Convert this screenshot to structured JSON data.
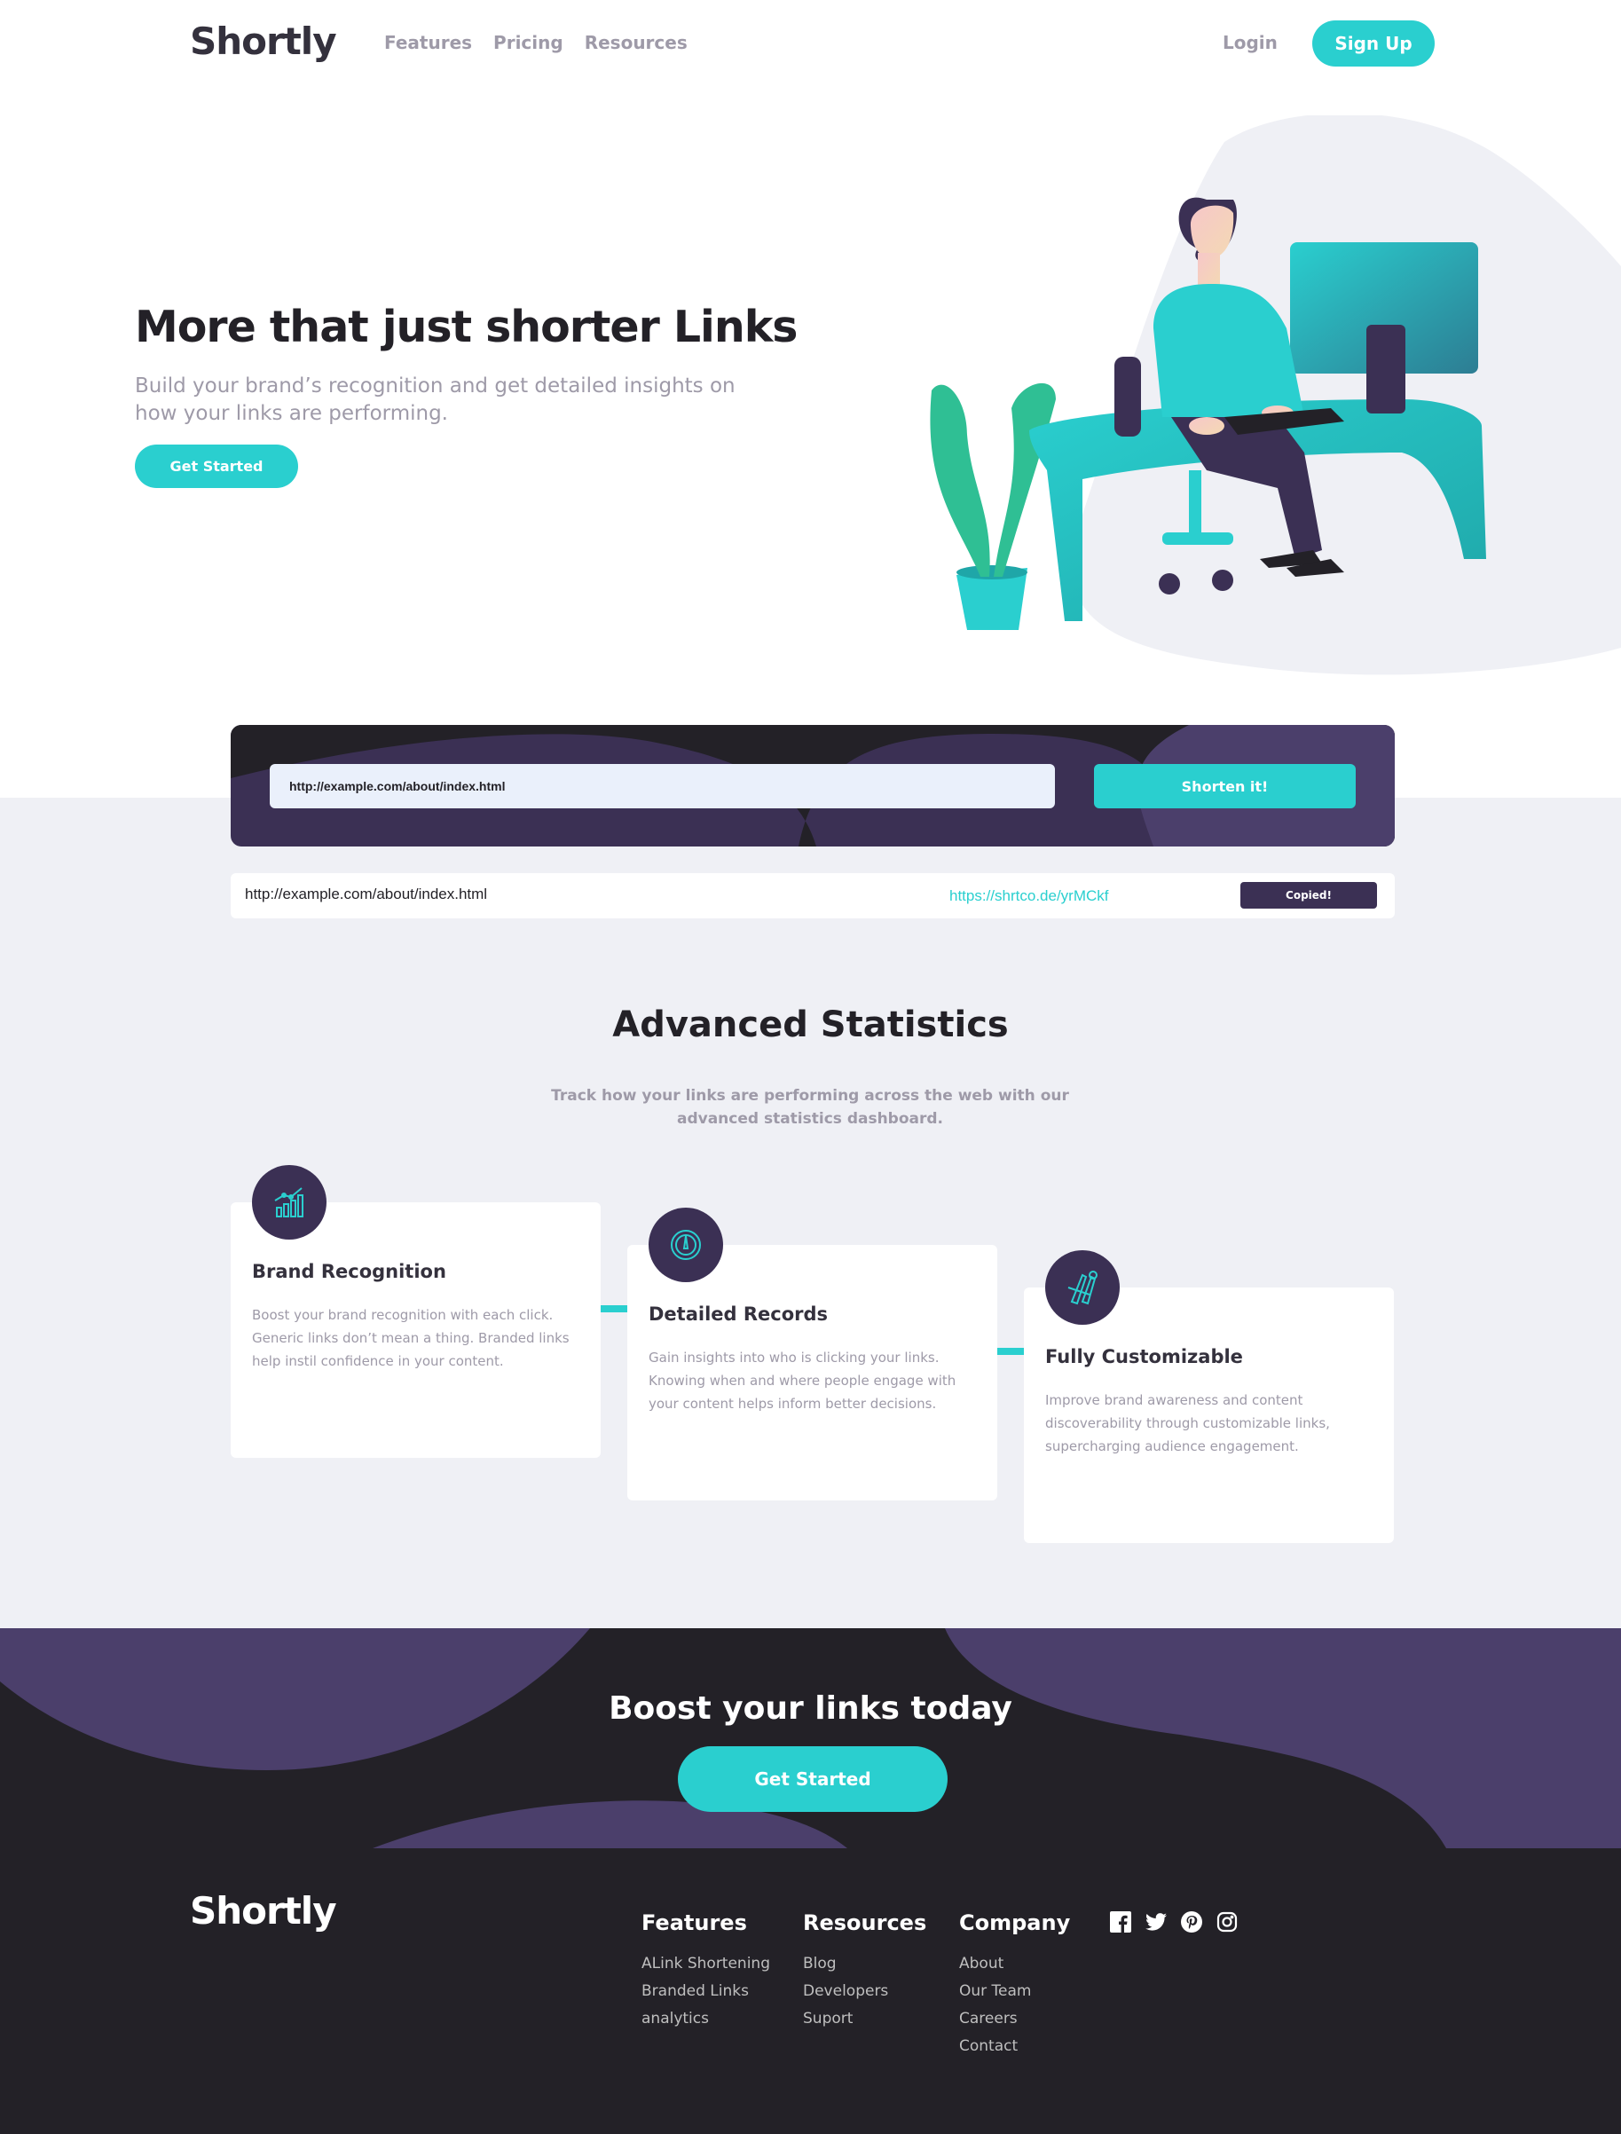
{
  "header": {
    "logo": "Shortly",
    "nav": [
      "Features",
      "Pricing",
      "Resources"
    ],
    "login": "Login",
    "signup": "Sign Up"
  },
  "hero": {
    "title": "More that just shorter Links",
    "subtitle": "Build your brand’s recognition and get detailed insights on how your links are performing.",
    "cta": "Get Started"
  },
  "shorten": {
    "input_value": "http://example.com/about/index.html",
    "button": "Shorten it!"
  },
  "result": {
    "original": "http://example.com/about/index.html",
    "short": "https://shrtco.de/yrMCkf",
    "copy_button": "Copied!"
  },
  "stats": {
    "title": "Advanced Statistics",
    "subtitle": "Track how your links are performing across the web with our advanced statistics dashboard.",
    "cards": [
      {
        "icon": "brand-recognition-icon",
        "title": "Brand Recognition",
        "text": "Boost your brand recognition with each click. Generic links don’t mean a thing. Branded links help instil confidence in your content."
      },
      {
        "icon": "detailed-records-icon",
        "title": "Detailed Records",
        "text": "Gain insights into who is clicking your links. Knowing when and where people engage with your content helps inform better decisions."
      },
      {
        "icon": "fully-customizable-icon",
        "title": "Fully Customizable",
        "text": "Improve brand awareness and content discoverability through customizable links, supercharging audience engagement."
      }
    ]
  },
  "boost": {
    "title": "Boost your links today",
    "cta": "Get Started"
  },
  "footer": {
    "logo": "Shortly",
    "columns": [
      {
        "title": "Features",
        "links": [
          "ALink Shortening",
          "Branded Links",
          "analytics"
        ]
      },
      {
        "title": "Resources",
        "links": [
          "Blog",
          "Developers",
          "Suport"
        ]
      },
      {
        "title": "Company",
        "links": [
          "About",
          "Our Team",
          "Careers",
          "Contact"
        ]
      }
    ],
    "socials": [
      "facebook-icon",
      "twitter-icon",
      "pinterest-icon",
      "instagram-icon"
    ]
  },
  "colors": {
    "cyan": "#2acfcf",
    "dark_violet": "#3b3054",
    "very_dark": "#232127",
    "grey_bg": "#eff0f5",
    "grey_text": "#9e9aa8"
  }
}
